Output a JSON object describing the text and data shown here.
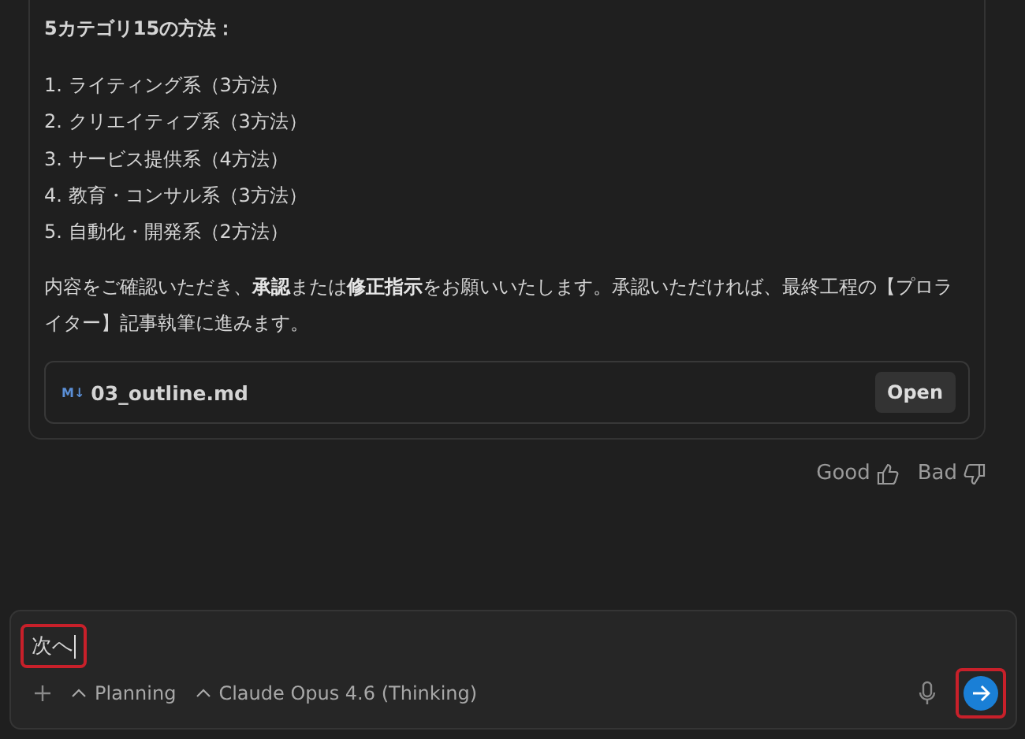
{
  "message": {
    "heading": "5カテゴリ15の方法：",
    "list": [
      "1. ライティング系（3方法）",
      "2. クリエイティブ系（3方法）",
      "3. サービス提供系（4方法）",
      "4. 教育・コンサル系（3方法）",
      "5. 自動化・開発系（2方法）"
    ],
    "paragraph": "内容をご確認いただき、**承認**または**修正指示**をお願いいたします。承認いただければ、最終工程の【プロライター】記事執筆に進みます。",
    "file": {
      "icon_text": "M↓",
      "name": "03_outline.md",
      "button": "Open"
    }
  },
  "feedback": [
    {
      "kind": "good",
      "label": "Good"
    },
    {
      "kind": "bad",
      "label": "Bad"
    }
  ],
  "composer": {
    "value": "次へ",
    "highlighted": true,
    "mode": "Planning",
    "model": "Claude Opus 4.6 (Thinking)",
    "send_highlighted": true
  }
}
